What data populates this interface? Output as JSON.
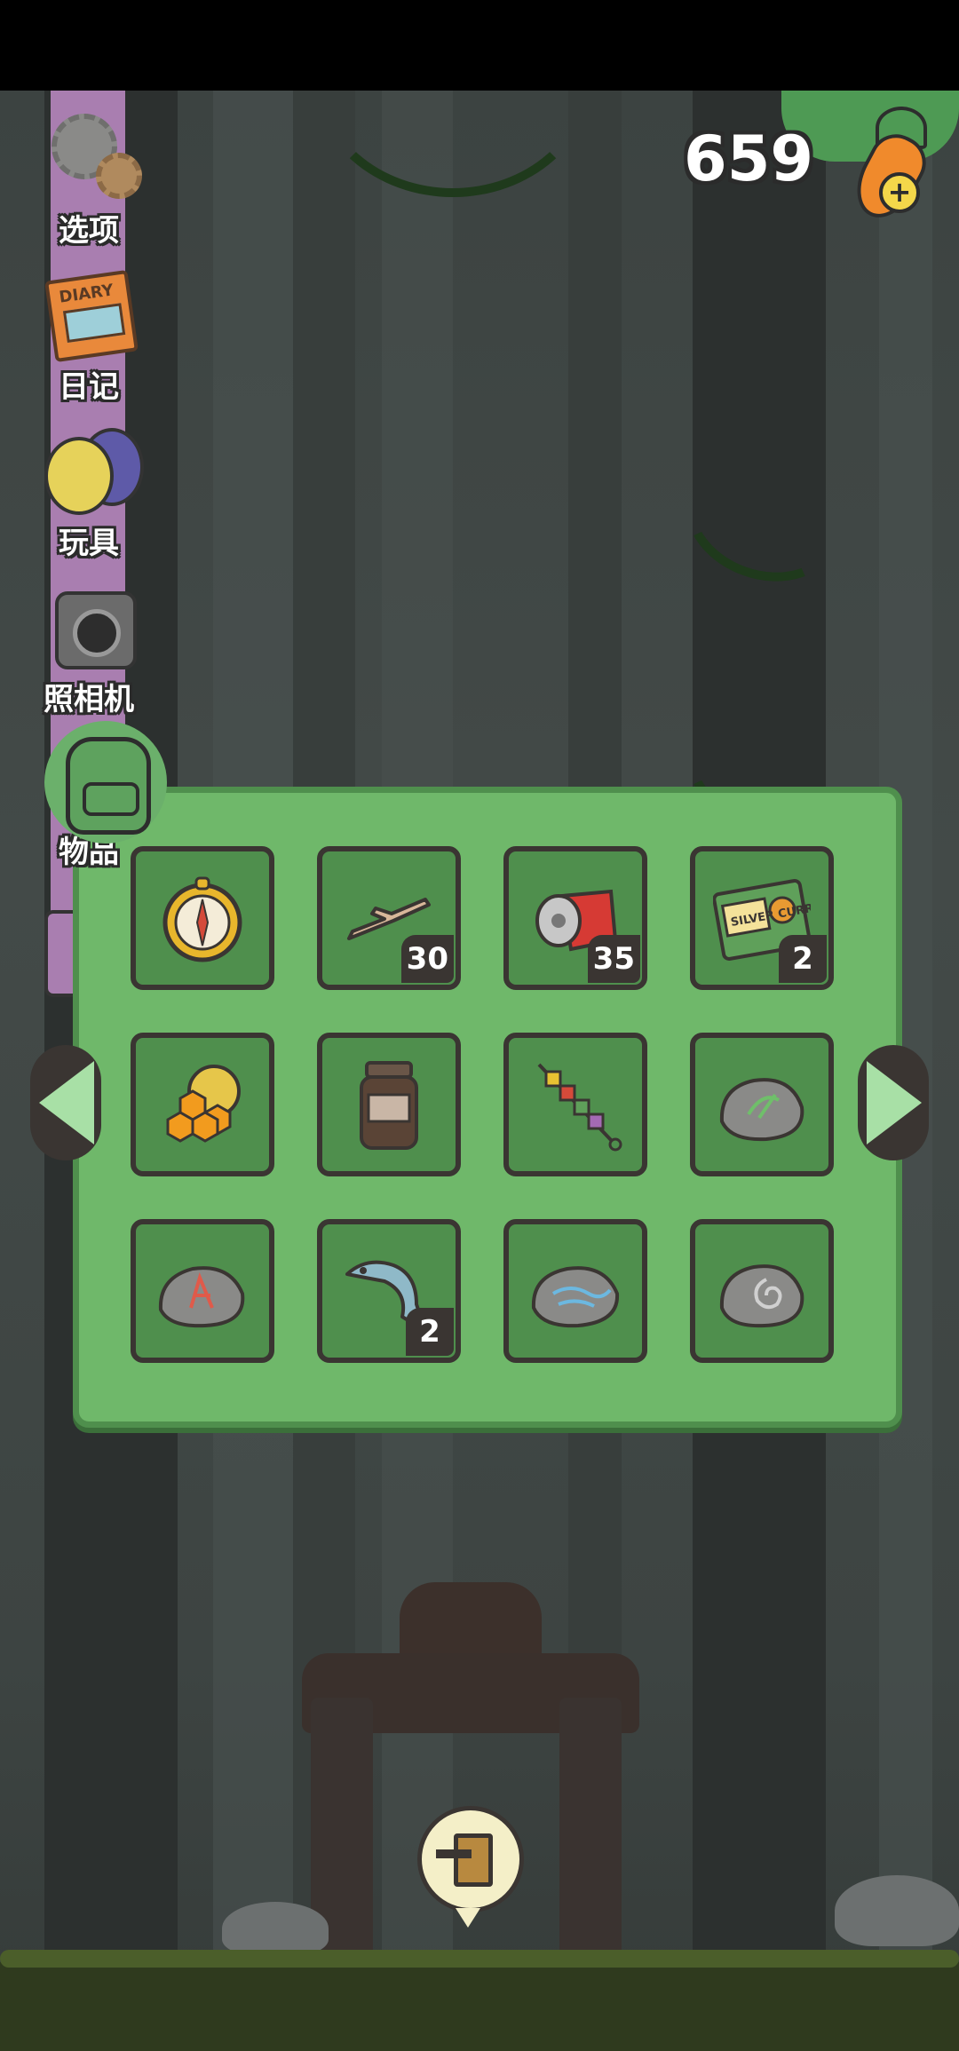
{
  "currency": {
    "amount": "659",
    "icon": "carrot-icon",
    "add_icon": "plus-icon"
  },
  "sidebar": {
    "items": [
      {
        "label": "选项",
        "icon": "gear-icon"
      },
      {
        "label": "日记",
        "icon": "diary-icon",
        "icon_text": "DIARY"
      },
      {
        "label": "玩具",
        "icon": "toy-balls-icon"
      },
      {
        "label": "照相机",
        "icon": "camera-icon"
      },
      {
        "label": "物品",
        "icon": "backpack-icon",
        "selected": true
      }
    ]
  },
  "inventory": {
    "slots": [
      {
        "item": "compass",
        "count": ""
      },
      {
        "item": "driftwood-stick",
        "count": "30"
      },
      {
        "item": "crushed-can",
        "count": "35"
      },
      {
        "item": "silver-curry-box",
        "count": "2",
        "icon_text": "SILVER CURRY"
      },
      {
        "item": "honeycomb",
        "count": ""
      },
      {
        "item": "jar",
        "count": ""
      },
      {
        "item": "kebab-skewer",
        "count": ""
      },
      {
        "item": "green-glyph-stone",
        "count": ""
      },
      {
        "item": "red-glyph-stone",
        "count": ""
      },
      {
        "item": "fish",
        "count": "2"
      },
      {
        "item": "wind-glyph-stone",
        "count": ""
      },
      {
        "item": "spiral-glyph-stone",
        "count": ""
      }
    ],
    "prev_icon": "left-arrow-icon",
    "next_icon": "right-arrow-icon"
  },
  "exit_button": {
    "icon": "exit-door-icon"
  },
  "colors": {
    "panel": "#6fb86a",
    "slot": "#4f8f4d",
    "sidebar": "#a97eb0",
    "arrow": "#a8e0a6"
  }
}
